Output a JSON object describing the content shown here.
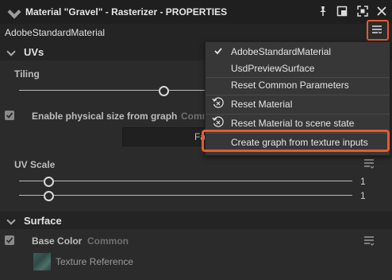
{
  "window": {
    "title": "Material \"Gravel\" - Rasterizer - PROPERTIES"
  },
  "subbar": {
    "material_type": "AdobeStandardMaterial"
  },
  "uvs": {
    "header": "UVs",
    "tiling_label": "Tiling",
    "physical_size_label": "Enable physical size from graph",
    "physical_size_tag": "Comm",
    "physical_size_checked": true,
    "button_label": "Fa",
    "uv_scale_label": "UV Scale",
    "uv_scale_values": [
      "1",
      "1"
    ]
  },
  "surface": {
    "header": "Surface",
    "base_color_label": "Base Color",
    "base_color_tag": "Common",
    "base_color_checked": true,
    "texture_label": "Texture Reference"
  },
  "menu": {
    "items": [
      {
        "label": "AdobeStandardMaterial",
        "checked": true
      },
      {
        "label": "UsdPreviewSurface",
        "checked": false
      },
      {
        "label": "Reset Common Parameters",
        "checked": false
      },
      {
        "label": "Reset Material",
        "icon": "reset-icon"
      },
      {
        "label": "Reset Material to scene state",
        "icon": "reset-icon"
      },
      {
        "label": "Create graph from texture inputs",
        "highlighted": true
      }
    ]
  },
  "colors": {
    "accent": "#e85a2c",
    "background": "#2b2b2b",
    "menu_bg": "#373737"
  }
}
